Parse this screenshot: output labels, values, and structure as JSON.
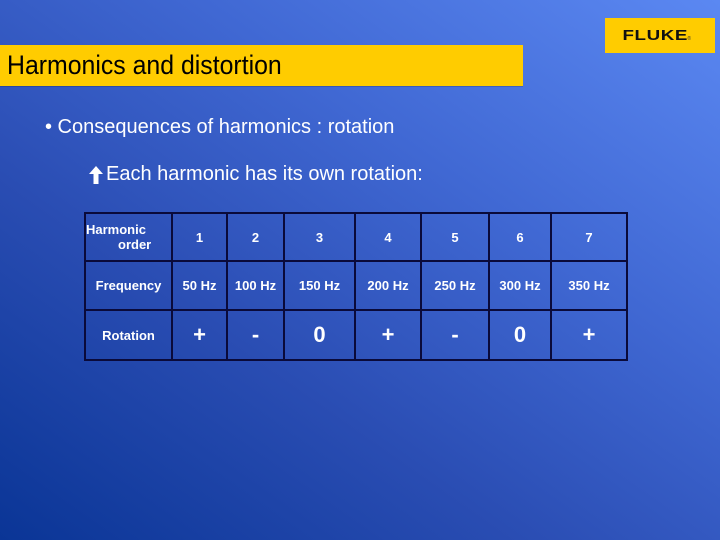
{
  "logo": {
    "text": "FLUKE",
    "mark": "®",
    "color": "#ffcc00"
  },
  "header": {
    "title": "Harmonics and distortion",
    "bar_color": "#ffcc00"
  },
  "content": {
    "bullet1": "• Consequences of harmonics : rotation",
    "bullet2_icon": "up-arrow-icon",
    "bullet2": "Each harmonic has its own rotation:"
  },
  "table": {
    "row_labels": {
      "order_line1": "Harmonic",
      "order_line2": "order",
      "frequency": "Frequency",
      "rotation": "Rotation"
    },
    "orders": [
      "1",
      "2",
      "3",
      "4",
      "5",
      "6",
      "7"
    ],
    "frequencies": [
      "50 Hz",
      "100 Hz",
      "150 Hz",
      "200 Hz",
      "250 Hz",
      "300 Hz",
      "350 Hz"
    ],
    "rotations": [
      "+",
      "-",
      "0",
      "+",
      "-",
      "0",
      "+"
    ]
  }
}
